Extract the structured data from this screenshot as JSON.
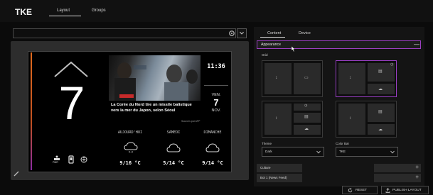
{
  "header": {
    "logo_text": "TKE",
    "tabs": [
      {
        "label": "Layout",
        "active": true
      },
      {
        "label": "Groups",
        "active": false
      }
    ]
  },
  "search": {
    "placeholder": ""
  },
  "preview": {
    "floor": "7",
    "accent_colors": [
      "#e06a1e",
      "#8a2aa5"
    ],
    "news": {
      "headline": "La Corée du Nord tire un missile balistique vers la mer du Japon, selon Séoul",
      "source": "Sources par AFP"
    },
    "clock": {
      "time": "11:36",
      "weekday": "VEN.",
      "day": "7",
      "month": "NOV."
    },
    "weather": [
      {
        "label": "AUJOURD'HUI",
        "icon": "snow-cloud-icon",
        "temp": "9/16 °C"
      },
      {
        "label": "SAMEDI",
        "icon": "cloud-icon",
        "temp": "5/14 °C"
      },
      {
        "label": "DIMANCHE",
        "icon": "cloud-icon",
        "temp": "9/14 °C"
      }
    ],
    "footer_icons": [
      "pmr-icon",
      "phone-icon",
      "accessibility-icon"
    ],
    "footer_label": "PMR"
  },
  "panel": {
    "tabs": [
      {
        "label": "Content",
        "active": true
      },
      {
        "label": "Device",
        "active": false
      }
    ],
    "appearance": {
      "label": "Appearance",
      "toggle": "—"
    },
    "grid_label": "Grid",
    "theme": {
      "label": "Theme",
      "value": "Dark"
    },
    "color_bar": {
      "label": "Color Bar",
      "value": "TKE"
    },
    "sections": [
      {
        "label": "Culture",
        "toggle": "+"
      },
      {
        "label": "Bot 1 (News Feed)",
        "toggle": "+"
      }
    ],
    "accent": "#9a3fc4"
  },
  "actions": {
    "reset": "RESET",
    "publish": "PUBLISH LAYOUT"
  }
}
